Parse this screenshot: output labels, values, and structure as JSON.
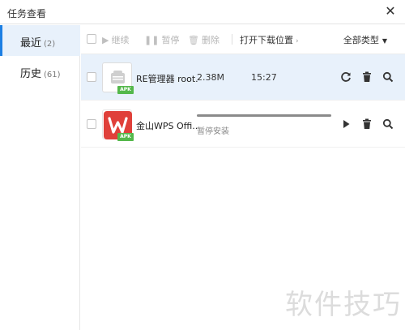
{
  "window": {
    "title": "任务查看"
  },
  "sidebar": {
    "items": [
      {
        "label": "最近",
        "count": "(2)"
      },
      {
        "label": "历史",
        "count": "(61)"
      }
    ]
  },
  "toolbar": {
    "continue_label": "继续",
    "pause_label": "暂停",
    "delete_label": "删除",
    "open_folder_label": "打开下载位置",
    "type_filter_label": "全部类型"
  },
  "tasks": [
    {
      "name": "RE管理器 root...",
      "size": "2.38M",
      "time": "15:27",
      "badge": "APK",
      "state": "completed"
    },
    {
      "name": "金山WPS Offi...",
      "status": "暂停安装",
      "progress": 1.0,
      "badge": "APK",
      "state": "paused"
    }
  ],
  "watermark": "软件技巧",
  "colors": {
    "accent": "#1c7fe3",
    "selected_bg": "#e8f1fb",
    "apk_badge": "#54b84b",
    "wps_red": "#e0403a"
  }
}
